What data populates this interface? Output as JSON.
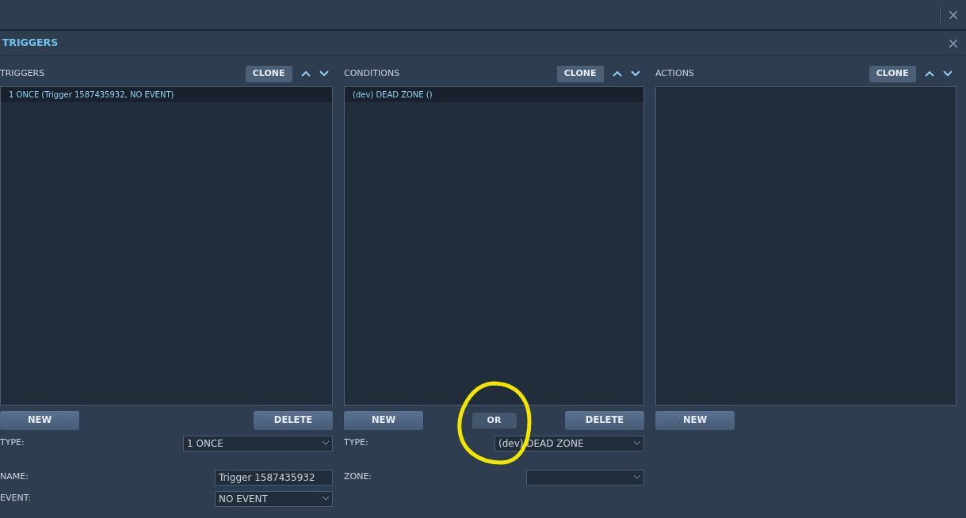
{
  "window": {
    "title": "TRIGGERS"
  },
  "panels": [
    {
      "title": "TRIGGERS",
      "clone": "CLONE",
      "items": [
        {
          "label": "1 ONCE (Trigger 1587435932, NO EVENT)",
          "selected": true
        }
      ],
      "buttons": [
        {
          "label": "NEW",
          "kind": "primary"
        },
        {
          "label": "DELETE",
          "kind": "primary"
        }
      ],
      "fields": [
        {
          "label": "TYPE:",
          "kind": "select",
          "value": "1 ONCE"
        },
        {
          "label": "NAME:",
          "kind": "text",
          "value": "Trigger 1587435932"
        },
        {
          "label": "EVENT:",
          "kind": "select",
          "value": "NO EVENT"
        }
      ]
    },
    {
      "title": "CONDITIONS",
      "clone": "CLONE",
      "items": [
        {
          "label": "(dev) DEAD ZONE ()",
          "selected": true
        }
      ],
      "buttons": [
        {
          "label": "NEW",
          "kind": "primary"
        },
        {
          "label": "OR",
          "kind": "small",
          "annotated": true
        },
        {
          "label": "DELETE",
          "kind": "primary"
        }
      ],
      "fields": [
        {
          "label": "TYPE:",
          "kind": "select",
          "value": "(dev) DEAD ZONE"
        },
        {
          "label": "ZONE:",
          "kind": "select"
        }
      ]
    },
    {
      "title": "ACTIONS",
      "clone": "CLONE",
      "buttons": [
        {
          "label": "NEW",
          "kind": "primary"
        }
      ]
    }
  ]
}
